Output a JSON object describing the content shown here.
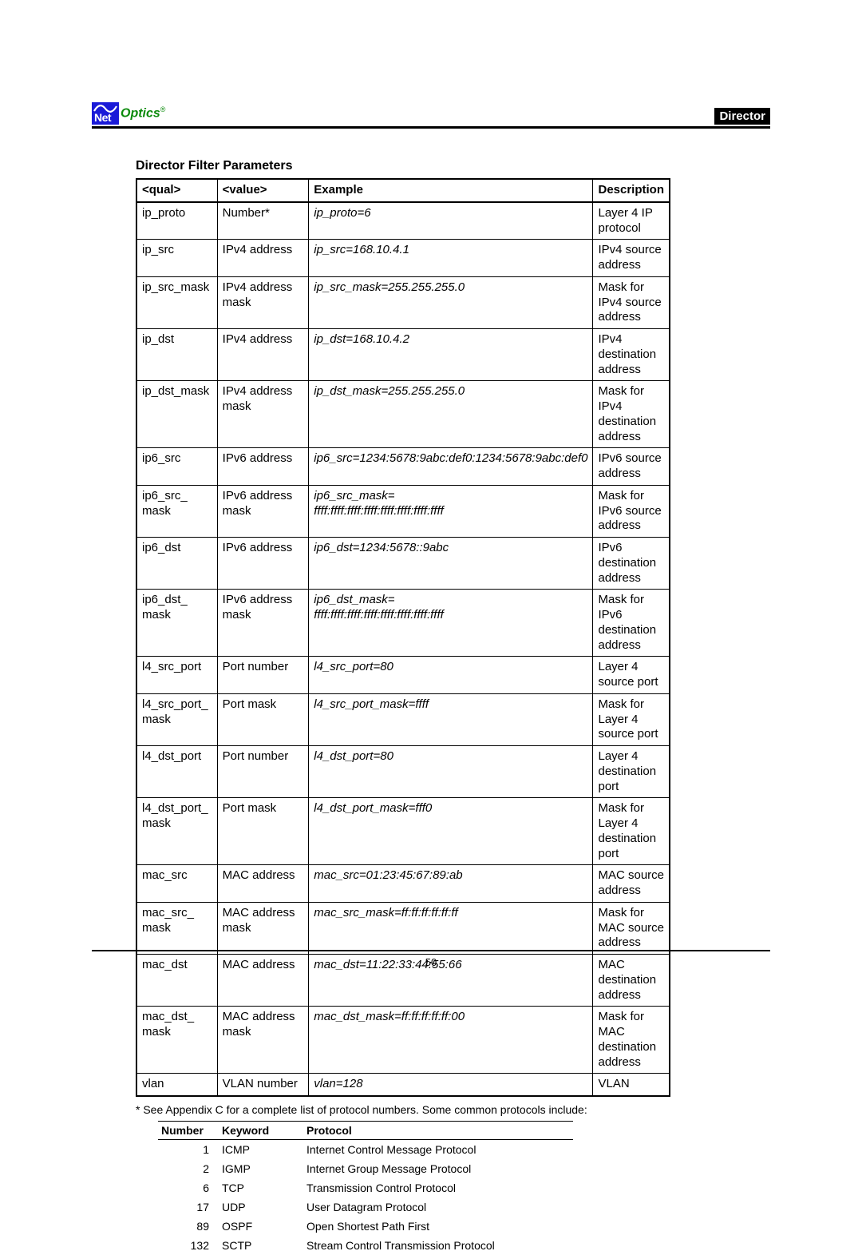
{
  "header": {
    "logo_net": "Net",
    "logo_optics": "Optics",
    "logo_reg": "®",
    "badge": "Director"
  },
  "section_title": "Director Filter Parameters",
  "columns": {
    "qual": "<qual>",
    "value": "<value>",
    "example": "Example",
    "description": "Description"
  },
  "rows": [
    {
      "qual": "ip_proto",
      "value": "Number*",
      "example": "ip_proto=6",
      "desc": "Layer 4 IP protocol"
    },
    {
      "qual": "ip_src",
      "value": "IPv4 address",
      "example": "ip_src=168.10.4.1",
      "desc": "IPv4 source address"
    },
    {
      "qual": "ip_src_mask",
      "value": "IPv4 address mask",
      "example": "ip_src_mask=255.255.255.0",
      "desc": "Mask for IPv4 source address"
    },
    {
      "qual": "ip_dst",
      "value": "IPv4 address",
      "example": "ip_dst=168.10.4.2",
      "desc": "IPv4 destination address"
    },
    {
      "qual": "ip_dst_mask",
      "value": "IPv4 address mask",
      "example": "ip_dst_mask=255.255.255.0",
      "desc": "Mask for IPv4 destination address"
    },
    {
      "qual": "ip6_src",
      "value": "IPv6 address",
      "example": "ip6_src=1234:5678:9abc:def0:1234:5678:9abc:def0",
      "desc": "IPv6 source address"
    },
    {
      "qual": "ip6_src_\nmask",
      "value": "IPv6 address mask",
      "example": "ip6_src_mask=\nffff:ffff:ffff:ffff:ffff:ffff:ffff:ffff",
      "desc": "Mask for IPv6 source address"
    },
    {
      "qual": "ip6_dst",
      "value": "IPv6 address",
      "example": "ip6_dst=1234:5678::9abc",
      "desc": "IPv6 destination address"
    },
    {
      "qual": "ip6_dst_\nmask",
      "value": "IPv6 address mask",
      "example": "ip6_dst_mask=\nffff:ffff:ffff:ffff:ffff:ffff:ffff:ffff",
      "desc": "Mask for IPv6 destination address"
    },
    {
      "qual": "l4_src_port",
      "value": "Port number",
      "example": "l4_src_port=80",
      "desc": "Layer 4 source port"
    },
    {
      "qual": "l4_src_port_\nmask",
      "value": "Port mask",
      "example": "l4_src_port_mask=ffff",
      "desc": "Mask for Layer 4 source port"
    },
    {
      "qual": "l4_dst_port",
      "value": "Port number",
      "example": "l4_dst_port=80",
      "desc": "Layer 4 destination port"
    },
    {
      "qual": "l4_dst_port_\nmask",
      "value": "Port mask",
      "example": "l4_dst_port_mask=fff0",
      "desc": "Mask for Layer 4 destination port"
    },
    {
      "qual": "mac_src",
      "value": "MAC address",
      "example": "mac_src=01:23:45:67:89:ab",
      "desc": "MAC source address"
    },
    {
      "qual": "mac_src_\nmask",
      "value": "MAC address mask",
      "example": "mac_src_mask=ff:ff:ff:ff:ff:ff",
      "desc": "Mask for MAC source address"
    },
    {
      "qual": "mac_dst",
      "value": "MAC address",
      "example": "mac_dst=11:22:33:44:55:66",
      "desc": "MAC destination address"
    },
    {
      "qual": "mac_dst_\nmask",
      "value": "MAC address mask",
      "example": "mac_dst_mask=ff:ff:ff:ff:ff:00",
      "desc": "Mask for MAC destination address"
    },
    {
      "qual": "vlan",
      "value": "VLAN number",
      "example": "vlan=128",
      "desc": "VLAN"
    }
  ],
  "footnote": "* See Appendix C for a complete list of protocol numbers. Some common protocols include:",
  "proto_columns": {
    "number": "Number",
    "keyword": "Keyword",
    "protocol": "Protocol"
  },
  "proto_rows": [
    {
      "num": "1",
      "kw": "ICMP",
      "proto": "Internet Control Message Protocol"
    },
    {
      "num": "2",
      "kw": "IGMP",
      "proto": "Internet Group Message Protocol"
    },
    {
      "num": "6",
      "kw": "TCP",
      "proto": "Transmission Control Protocol"
    },
    {
      "num": "17",
      "kw": "UDP",
      "proto": "User Datagram Protocol"
    },
    {
      "num": "89",
      "kw": "OSPF",
      "proto": "Open Shortest Path First"
    },
    {
      "num": "132",
      "kw": "SCTP",
      "proto": "Stream Control Transmission Protocol"
    }
  ],
  "page_number": "50"
}
